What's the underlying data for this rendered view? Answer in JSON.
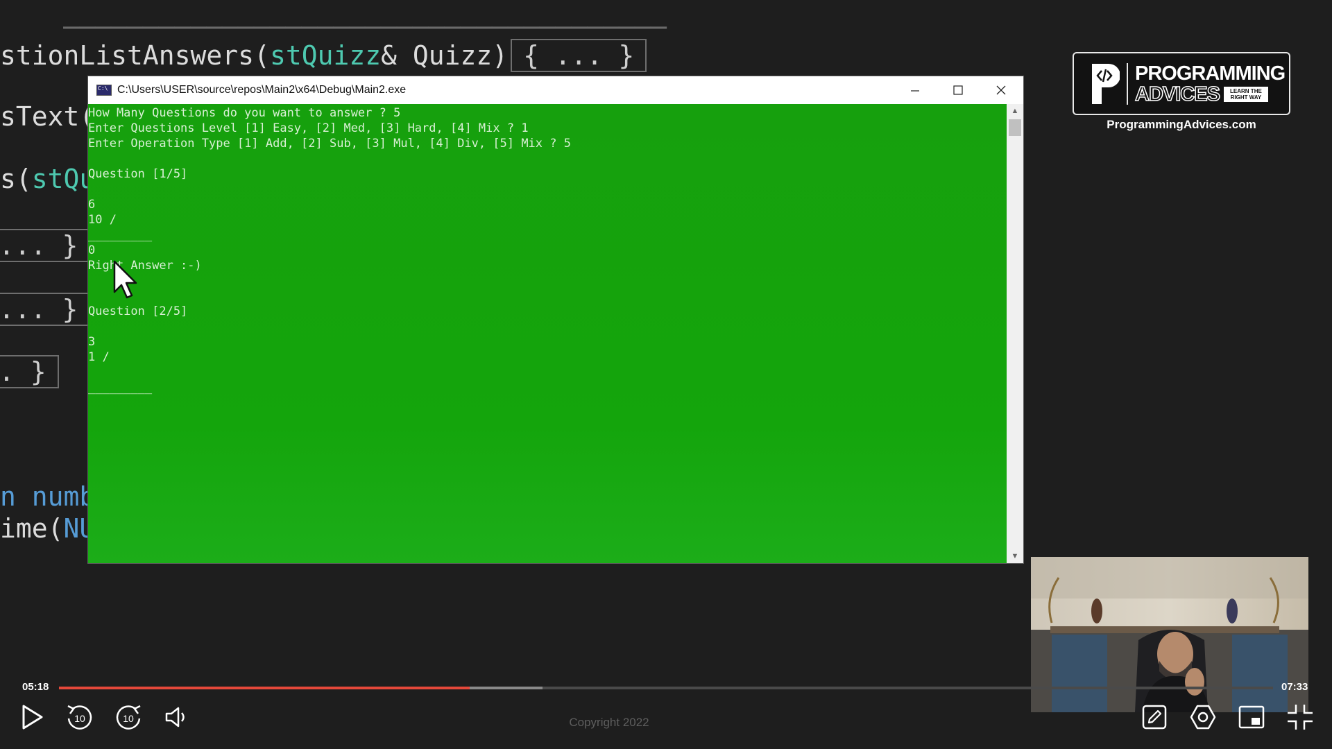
{
  "editor": {
    "line1_a": "stionListAnswers(",
    "line1_type": "stQuizz",
    "line1_b": "& Quizz)",
    "fold_1": "{ ... }",
    "line2": "sText(",
    "line3_a": "s(",
    "line3_type": "stQu",
    "fold_2": "... }",
    "fold_3": "... }",
    "fold_4": ". }",
    "line4": "n numbe",
    "line5_a": "ime(",
    "line5_b": "NUl"
  },
  "console": {
    "title": "C:\\Users\\USER\\source\\repos\\Main2\\x64\\Debug\\Main2.exe",
    "lines": [
      "How Many Questions do you want to answer ? 5",
      "Enter Questions Level [1] Easy, [2] Med, [3] Hard, [4] Mix ? 1",
      "Enter Operation Type [1] Add, [2] Sub, [3] Mul, [4] Div, [5] Mix ? 5",
      "",
      "Question [1/5]",
      "",
      "6",
      "10 /",
      "_________",
      "0",
      "Right Answer :-)",
      "",
      "",
      "Question [2/5]",
      "",
      "3",
      "1 /",
      "",
      "_________"
    ]
  },
  "logo": {
    "line1": "PROGRAMMING",
    "line2": "ADVICES",
    "tagline": "LEARN THE RIGHT WAY",
    "url": "ProgrammingAdvices.com"
  },
  "player": {
    "current_time": "05:18",
    "total_time": "07:33",
    "progress": 0.338,
    "buffered": 0.398,
    "rewind_label": "10",
    "forward_label": "10",
    "copyright": "Copyright 2022",
    "accent_color": "#e5483a"
  },
  "icons": [
    "play-icon",
    "rewind-10-icon",
    "forward-10-icon",
    "volume-icon",
    "edit-icon",
    "settings-icon",
    "picture-in-picture-icon",
    "exit-fullscreen-icon",
    "mouse-cursor-icon"
  ]
}
